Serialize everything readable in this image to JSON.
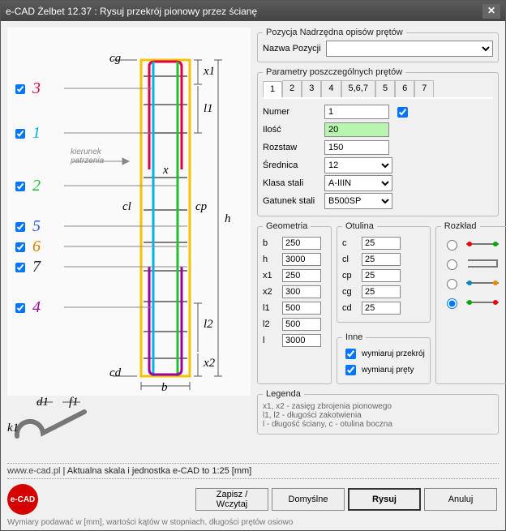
{
  "window": {
    "title": "e-CAD Żelbet 12.37 : Rysuj przekrój pionowy przez ścianę"
  },
  "sections": {
    "position": "Pozycja Nadrzędna opisów prętów",
    "position_label": "Nazwa Pozycji",
    "params": "Parametry poszczególnych prętów",
    "geometry": "Geometria",
    "cover": "Otulina",
    "layout": "Rozkład",
    "other": "Inne",
    "legend": "Legenda"
  },
  "bars": [
    {
      "n": "3",
      "color": "#e00045"
    },
    {
      "n": "1",
      "color": "#00b4e6"
    },
    {
      "n": "2",
      "color": "#20c030"
    },
    {
      "n": "5",
      "color": "#3060e0"
    },
    {
      "n": "6",
      "color": "#e08000"
    },
    {
      "n": "7",
      "color": "#222"
    },
    {
      "n": "4",
      "color": "#a000a0"
    }
  ],
  "dims": {
    "cg": "cg",
    "cd": "cd",
    "x1": "x1",
    "l1": "l1",
    "l2": "l2",
    "x2": "x2",
    "b": "b",
    "h": "h",
    "cp": "cp",
    "cl": "cl",
    "x": "x",
    "kierunek": "kierunek",
    "patrzenia": "patrzenia",
    "d1": "d1",
    "f1": "f1",
    "k1": "k1"
  },
  "tabs": [
    "1",
    "2",
    "3",
    "4",
    "5,6,7",
    "5",
    "6",
    "7"
  ],
  "param_fields": {
    "numer_label": "Numer",
    "numer": "1",
    "ilosc_label": "Ilość",
    "ilosc": "20",
    "rozstaw_label": "Rozstaw",
    "rozstaw": "150",
    "srednica_label": "Średnica",
    "srednica": "12",
    "klasa_label": "Klasa stali",
    "klasa": "A-IIIN",
    "gatunek_label": "Gatunek stali",
    "gatunek": "B500SP"
  },
  "geometry": {
    "b_l": "b",
    "b": "250",
    "h_l": "h",
    "h": "3000",
    "x1_l": "x1",
    "x1": "250",
    "x2_l": "x2",
    "x2": "300",
    "l1_l": "l1",
    "l1": "500",
    "l2_l": "l2",
    "l2": "500",
    "l_l": "l",
    "l": "3000"
  },
  "cover": {
    "c_l": "c",
    "c": "25",
    "cl_l": "cl",
    "cl": "25",
    "cp_l": "cp",
    "cp": "25",
    "cg_l": "cg",
    "cg": "25",
    "cd_l": "cd",
    "cd": "25"
  },
  "other": {
    "dim_section": "wymiaruj przekrój",
    "dim_bars": "wymiaruj pręty"
  },
  "legend_lines": [
    "x1, x2 - zasięg zbrojenia pionowego",
    "l1, l2 - długości zakotwienia",
    "l - długość ściany, c - otulina boczna"
  ],
  "footer": {
    "url": "www.e-cad.pl",
    "status_tail": " | Aktualna skala i jednostka e-CAD to 1:25 [mm]",
    "logo": "e-CAD",
    "save": "Zapisz / Wczytaj",
    "default": "Domyślne",
    "draw": "Rysuj",
    "cancel": "Anuluj",
    "hint": "Wymiary podawać w [mm], wartości kątów w stopniach, długości prętów osiowo"
  }
}
